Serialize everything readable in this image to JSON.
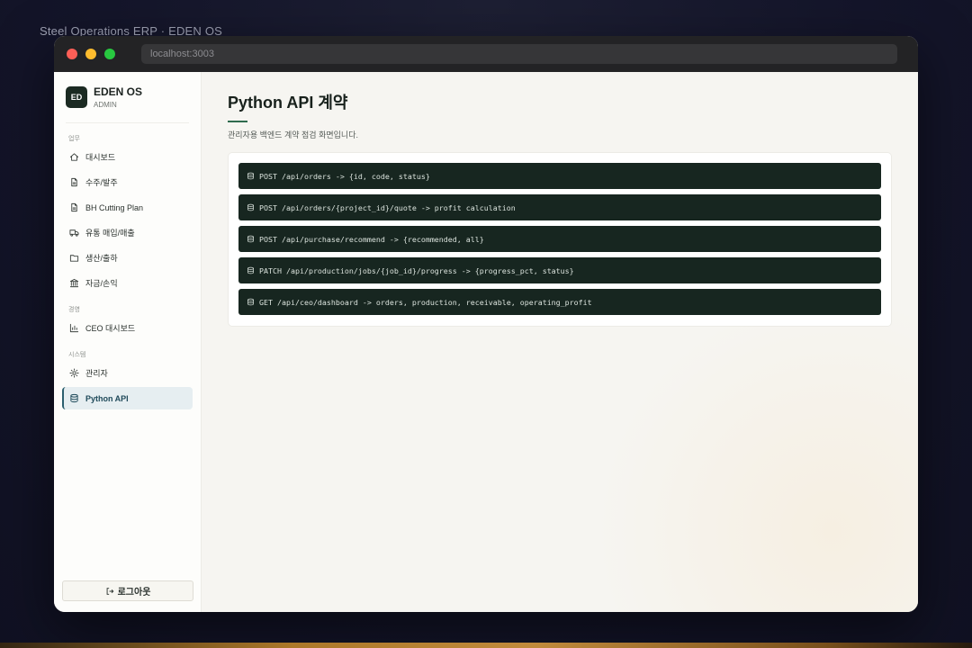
{
  "outer": {
    "title": "Steel Operations ERP · EDEN OS"
  },
  "browser": {
    "url": "localhost:3003"
  },
  "brand": {
    "logo": "ED",
    "name": "EDEN OS",
    "role": "ADMIN"
  },
  "sidebar": {
    "sections": [
      {
        "label": "업무",
        "items": [
          {
            "label": "대시보드",
            "icon": "home-icon"
          },
          {
            "label": "수주/발주",
            "icon": "document-icon"
          },
          {
            "label": "BH Cutting Plan",
            "icon": "document-icon"
          },
          {
            "label": "유통 매입/매출",
            "icon": "truck-icon"
          },
          {
            "label": "생산/출하",
            "icon": "folder-icon"
          },
          {
            "label": "자금/손익",
            "icon": "bank-icon"
          }
        ]
      },
      {
        "label": "경영",
        "items": [
          {
            "label": "CEO 대시보드",
            "icon": "bar-chart-icon"
          }
        ]
      },
      {
        "label": "시스템",
        "items": [
          {
            "label": "관리자",
            "icon": "gear-icon"
          },
          {
            "label": "Python API",
            "icon": "database-icon",
            "active": true
          }
        ]
      }
    ],
    "logout_label": "로그아웃"
  },
  "main": {
    "title": "Python API 계약",
    "subtitle": "관리자용 백엔드 계약 점검 화면입니다.",
    "endpoints": [
      "POST /api/orders -> {id, code, status}",
      "POST /api/orders/{project_id}/quote -> profit calculation",
      "POST /api/purchase/recommend -> {recommended, all}",
      "PATCH /api/production/jobs/{job_id}/progress -> {progress_pct, status}",
      "GET /api/ceo/dashboard -> orders, production, receivable, operating_profit"
    ]
  },
  "colors": {
    "accent": "#2f6b4f",
    "active_nav_bg": "#e6eef1",
    "code_bg": "#172620"
  }
}
